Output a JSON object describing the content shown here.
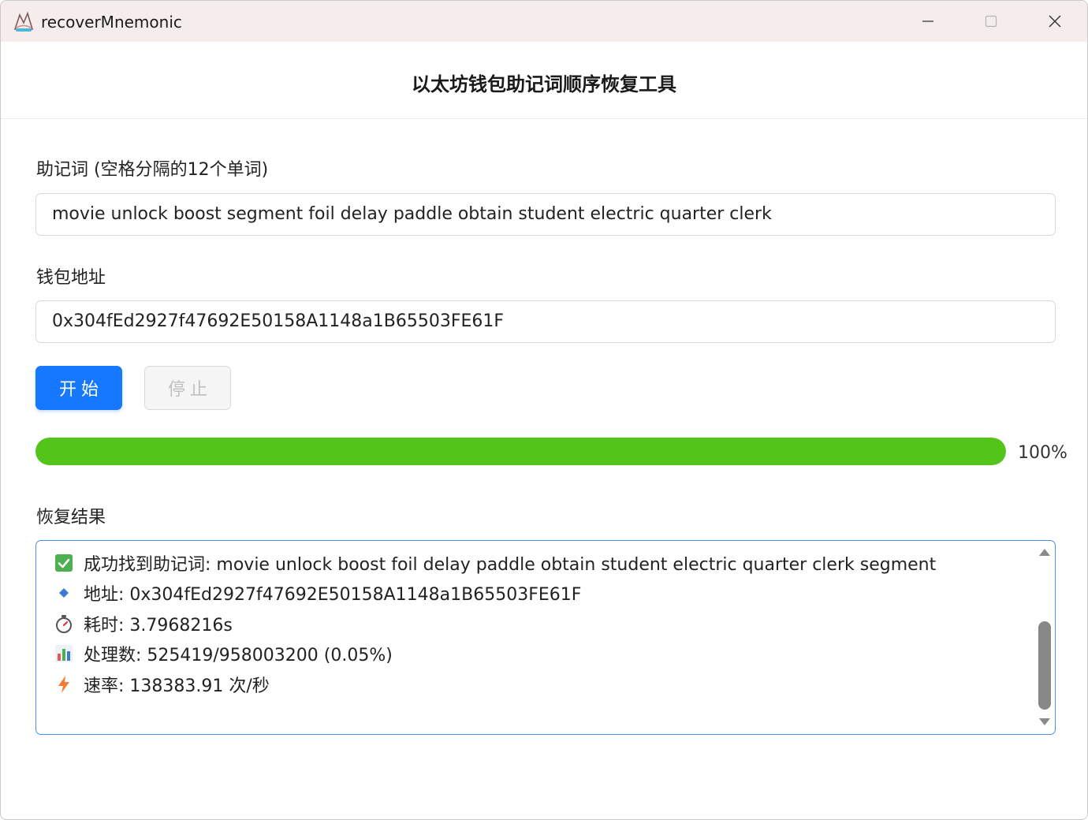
{
  "window": {
    "title": "recoverMnemonic",
    "controls": [
      "minimize-icon",
      "maximize-icon",
      "close-icon"
    ]
  },
  "header": {
    "title": "以太坊钱包助记词顺序恢复工具"
  },
  "form": {
    "mnemonic_label": "助记词 (空格分隔的12个单词)",
    "mnemonic_value": "movie unlock boost segment foil delay paddle obtain student electric quarter clerk",
    "address_label": "钱包地址",
    "address_value": "0x304fEd2927f47692E50158A1148a1B65503FE61F"
  },
  "actions": {
    "start_label": "开始",
    "stop_label": "停止",
    "stop_disabled": true
  },
  "progress": {
    "percent": 100,
    "text": "100%",
    "color": "#52c41a"
  },
  "results": {
    "title": "恢复结果",
    "lines": [
      {
        "icon": "check-mark-icon",
        "text": "成功找到助记词: movie unlock boost foil delay paddle obtain student electric quarter clerk segment"
      },
      {
        "icon": "diamond-icon",
        "text": "地址: 0x304fEd2927f47692E50158A1148a1B65503FE61F"
      },
      {
        "icon": "stopwatch-icon",
        "text": "耗时: 3.7968216s"
      },
      {
        "icon": "bar-chart-icon",
        "text": "处理数: 525419/958003200 (0.05%)"
      },
      {
        "icon": "lightning-icon",
        "text": "速率: 138383.91 次/秒"
      }
    ]
  },
  "colors": {
    "primary": "#1677ff",
    "success": "#52c41a",
    "titlebar": "#f5ecec",
    "result_border": "#4e8ee6"
  }
}
